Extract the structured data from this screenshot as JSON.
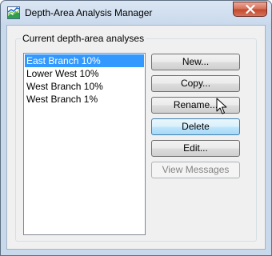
{
  "window": {
    "title": "Depth-Area Analysis Manager"
  },
  "group": {
    "label": "Current depth-area analyses"
  },
  "analyses": [
    {
      "label": "East Branch 10%",
      "selected": true
    },
    {
      "label": "Lower West 10%",
      "selected": false
    },
    {
      "label": "West Branch 10%",
      "selected": false
    },
    {
      "label": "West Branch 1%",
      "selected": false
    }
  ],
  "buttons": {
    "new": "New...",
    "copy": "Copy...",
    "rename": "Rename...",
    "delete": "Delete",
    "edit": "Edit...",
    "view_messages": "View Messages"
  },
  "colors": {
    "selection": "#3399ff",
    "close_button": "#c24a2f",
    "hover_button": "#bee6fd"
  },
  "icons": {
    "app": "depth-area-chart-icon",
    "close": "close-icon",
    "cursor": "mouse-pointer-icon"
  }
}
